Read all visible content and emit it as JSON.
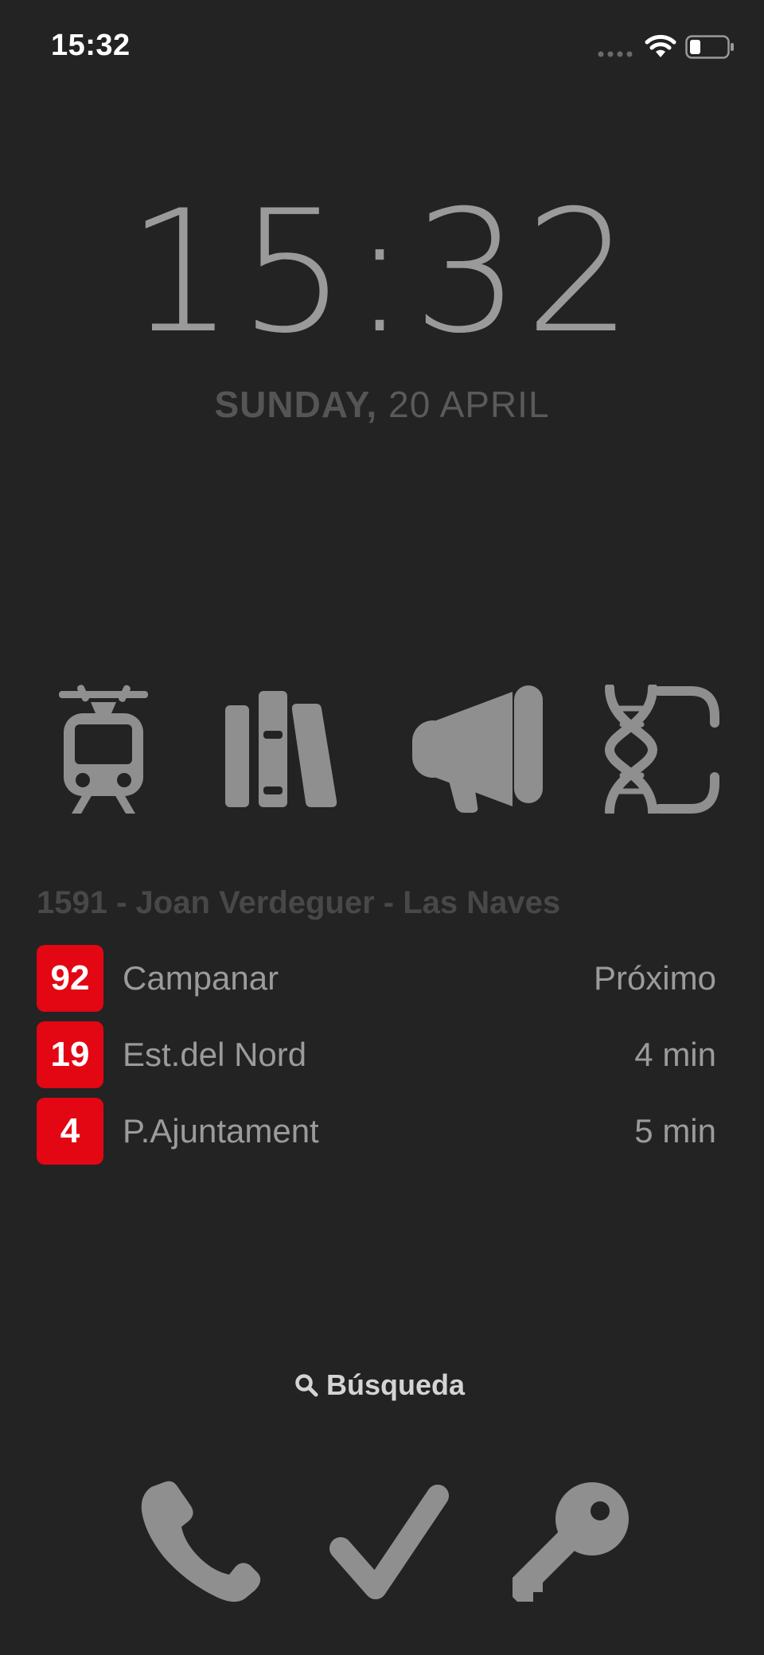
{
  "status_bar": {
    "time": "15:32"
  },
  "lockscreen": {
    "clock": "15:32",
    "weekday": "SUNDAY,",
    "day": "20 APRIL"
  },
  "apps": [
    {
      "name": "tram",
      "icon": "tram-icon"
    },
    {
      "name": "library",
      "icon": "books-icon"
    },
    {
      "name": "announcements",
      "icon": "megaphone-icon"
    },
    {
      "name": "science",
      "icon": "dna-icon"
    }
  ],
  "transit": {
    "stop_title": "1591 - Joan Verdeguer - Las Naves",
    "badge_color": "#e30613",
    "routes": [
      {
        "line": "92",
        "destination": "Campanar",
        "eta": "Próximo"
      },
      {
        "line": "19",
        "destination": "Est.del Nord",
        "eta": "4 min"
      },
      {
        "line": "4",
        "destination": "P.Ajuntament",
        "eta": "5 min"
      }
    ]
  },
  "search": {
    "label": "Búsqueda"
  },
  "dock": [
    {
      "name": "phone",
      "icon": "phone-icon"
    },
    {
      "name": "check",
      "icon": "checkmark-icon"
    },
    {
      "name": "key",
      "icon": "key-icon"
    }
  ],
  "colors": {
    "background": "#232323",
    "icon": "#8f8f8f",
    "accent": "#e30613"
  }
}
